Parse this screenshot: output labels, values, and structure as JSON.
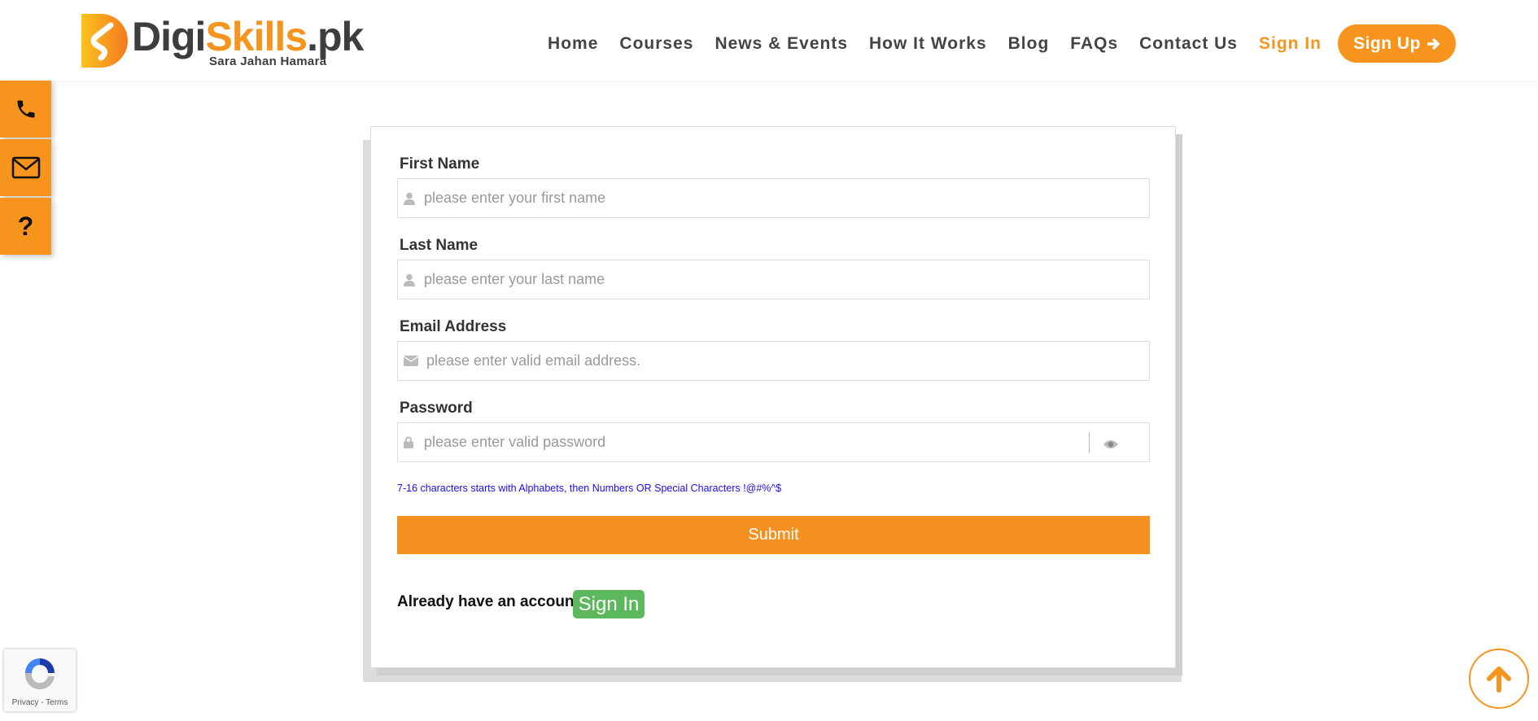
{
  "logo": {
    "word_dark": "Digi",
    "word_orange": "Skills",
    "word_suffix": ".pk",
    "tagline": "Sara Jahan Hamara"
  },
  "nav": {
    "items": [
      "Home",
      "Courses",
      "News & Events",
      "How It Works",
      "Blog",
      "FAQs",
      "Contact Us"
    ],
    "sign_in": "Sign In",
    "sign_up": "Sign Up"
  },
  "side": {
    "icons": [
      "phone-icon",
      "envelope-icon",
      "question-icon"
    ]
  },
  "form": {
    "first_name": {
      "label": "First Name",
      "placeholder": "please enter your first name"
    },
    "last_name": {
      "label": "Last Name",
      "placeholder": "please enter your last name"
    },
    "email": {
      "label": "Email Address",
      "placeholder": "please enter valid email address."
    },
    "password": {
      "label": "Password",
      "placeholder": "please enter valid password"
    },
    "hint": "7-16 characters starts with Alphabets, then Numbers OR Special Characters !@#%^$",
    "submit": "Submit",
    "already": "Already have an account?",
    "sign_in": "Sign In"
  },
  "recaptcha": {
    "links": "Privacy - Terms"
  },
  "colors": {
    "accent": "#f7941e",
    "green": "#5cb85c",
    "hint": "#1b0cf5"
  }
}
